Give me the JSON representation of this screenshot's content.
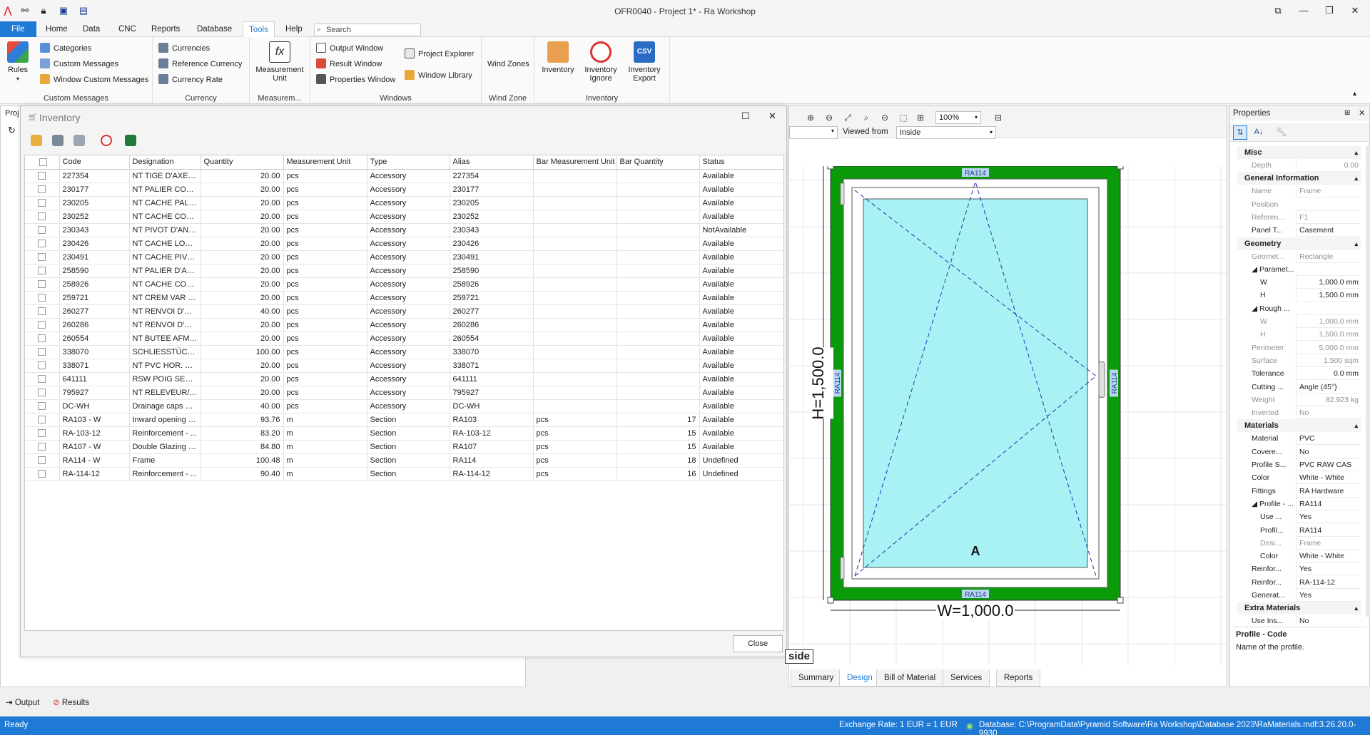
{
  "window": {
    "title": "OFR0040 - Project 1* - Ra Workshop"
  },
  "menu": {
    "file": "File",
    "items": [
      "Home",
      "Data",
      "CNC",
      "Reports",
      "Database",
      "Tools",
      "Help"
    ],
    "active": "Tools",
    "search_placeholder": "Search"
  },
  "ribbon": {
    "rules": "Rules",
    "custom_messages": {
      "label": "Custom Messages",
      "items": [
        "Categories",
        "Custom Messages",
        "Window Custom Messages"
      ]
    },
    "currency": {
      "label": "Currency",
      "items": [
        "Currencies",
        "Reference Currency",
        "Currency Rate"
      ]
    },
    "measurement": {
      "label": "Measurem...",
      "button": "Measurement Unit"
    },
    "windows": {
      "label": "Windows",
      "col1": [
        "Output Window",
        "Result Window",
        "Properties Window"
      ],
      "col2": [
        "Project Explorer",
        "Window Library"
      ]
    },
    "windzone": {
      "label": "Wind Zone",
      "button": "Wind Zones"
    },
    "inventory": {
      "label": "Inventory",
      "buttons": [
        "Inventory",
        "Inventory Ignore",
        "Inventory Export"
      ]
    }
  },
  "left_panel_title": "Proj",
  "inventory": {
    "title": "Inventory",
    "columns": [
      "Code",
      "Designation",
      "Quantity",
      "Measurement Unit",
      "Type",
      "Alias",
      "Bar Measurement Unit",
      "Bar Quantity",
      "Status"
    ],
    "rows": [
      [
        "227354",
        "NT TIGE D'AXE 71",
        "20.00",
        "pcs",
        "Accessory",
        "227354",
        "",
        "",
        "Available"
      ],
      [
        "230177",
        "NT PALIER COMP...",
        "20.00",
        "pcs",
        "Accessory",
        "230177",
        "",
        "",
        "Available"
      ],
      [
        "230205",
        "NT CACHE PALIE...",
        "20.00",
        "pcs",
        "Accessory",
        "230205",
        "",
        "",
        "Available"
      ],
      [
        "230252",
        "NT CACHE COMP...",
        "20.00",
        "pcs",
        "Accessory",
        "230252",
        "",
        "",
        "Available"
      ],
      [
        "230343",
        "NT PIVOT D'ANG...",
        "20.00",
        "pcs",
        "Accessory",
        "230343",
        "",
        "",
        "NotAvailable"
      ],
      [
        "230426",
        "NT CACHE LONG ...",
        "20.00",
        "pcs",
        "Accessory",
        "230426",
        "",
        "",
        "Available"
      ],
      [
        "230491",
        "NT CACHE PIVOT...",
        "20.00",
        "pcs",
        "Accessory",
        "230491",
        "",
        "",
        "Available"
      ],
      [
        "258590",
        "NT PALIER D'AN...",
        "20.00",
        "pcs",
        "Accessory",
        "258590",
        "",
        "",
        "Available"
      ],
      [
        "258926",
        "NT CACHE COUR...",
        "20.00",
        "pcs",
        "Accessory",
        "258926",
        "",
        "",
        "Available"
      ],
      [
        "259721",
        "NT CREM VAR F1...",
        "20.00",
        "pcs",
        "Accessory",
        "259721",
        "",
        "",
        "Available"
      ],
      [
        "260277",
        "NT RENVOI D'AN...",
        "40.00",
        "pcs",
        "Accessory",
        "260277",
        "",
        "",
        "Available"
      ],
      [
        "260286",
        "NT RENVOI D'AN...",
        "20.00",
        "pcs",
        "Accessory",
        "260286",
        "",
        "",
        "Available"
      ],
      [
        "260554",
        "NT BUTEE AFM R...",
        "20.00",
        "pcs",
        "Accessory",
        "260554",
        "",
        "",
        "Available"
      ],
      [
        "338070",
        "SCHLIESSTÜCK K...",
        "100.00",
        "pcs",
        "Accessory",
        "338070",
        "",
        "",
        "Available"
      ],
      [
        "338071",
        "NT PVC HOR. T&...",
        "20.00",
        "pcs",
        "Accessory",
        "338071",
        "",
        "",
        "Available"
      ],
      [
        "641111",
        "RSW POIG SEC C...",
        "20.00",
        "pcs",
        "Accessory",
        "641111",
        "",
        "",
        "Available"
      ],
      [
        "795927",
        "NT RELEVEUR/AFM",
        "20.00",
        "pcs",
        "Accessory",
        "795927",
        "",
        "",
        "Available"
      ],
      [
        "DC-WH",
        "Drainage caps W...",
        "40.00",
        "pcs",
        "Accessory",
        "DC-WH",
        "",
        "",
        "Available"
      ],
      [
        "RA103 - W",
        "Inward opening c...",
        "93.76",
        "m",
        "Section",
        "RA103",
        "pcs",
        "17",
        "Available"
      ],
      [
        "RA-103-12",
        "Reinforcement - ...",
        "83.20",
        "m",
        "Section",
        "RA-103-12",
        "pcs",
        "15",
        "Available"
      ],
      [
        "RA107 - W",
        "Double Glazing B...",
        "84.80",
        "m",
        "Section",
        "RA107",
        "pcs",
        "15",
        "Available"
      ],
      [
        "RA114 - W",
        "Frame",
        "100.48",
        "m",
        "Section",
        "RA114",
        "pcs",
        "18",
        "Undefined"
      ],
      [
        "RA-114-12",
        "Reinforcement - ...",
        "90.40",
        "m",
        "Section",
        "RA-114-12",
        "pcs",
        "16",
        "Undefined"
      ]
    ],
    "close": "Close"
  },
  "design": {
    "zoom": "100%",
    "viewed_from_label": "Viewed from",
    "viewed_from": "Inside",
    "profile_label": "RA114",
    "height_label": "H=1,500.0",
    "width_label": "W=1,000.0",
    "sash_label": "A",
    "inside_tag": "side",
    "tabs": [
      "Summary",
      "Design",
      "Bill of Material",
      "Services",
      "Reports"
    ],
    "active_tab": "Design"
  },
  "properties": {
    "title": "Properties",
    "sections": [
      {
        "name": "Misc",
        "rows": [
          {
            "k": "Depth",
            "v": "0.00",
            "dim": true,
            "r": true
          }
        ]
      },
      {
        "name": "General Information",
        "rows": [
          {
            "k": "Name",
            "v": "Frame",
            "dim": true
          },
          {
            "k": "Position",
            "v": "",
            "dim": true
          },
          {
            "k": "Referen...",
            "v": "F1",
            "dim": true
          },
          {
            "k": "Panel T...",
            "v": "Casement"
          }
        ]
      },
      {
        "name": "Geometry",
        "rows": [
          {
            "k": "Geomet...",
            "v": "Rectangle",
            "dim": true
          },
          {
            "k": "◢ Paramet...",
            "v": ""
          },
          {
            "k": "W",
            "v": "1,000.0 mm",
            "r": true,
            "ind": true
          },
          {
            "k": "H",
            "v": "1,500.0 mm",
            "r": true,
            "ind": true
          },
          {
            "k": "◢ Rough ...",
            "v": ""
          },
          {
            "k": "W",
            "v": "1,000.0 mm",
            "dim": true,
            "r": true,
            "ind": true
          },
          {
            "k": "H",
            "v": "1,500.0 mm",
            "dim": true,
            "r": true,
            "ind": true
          },
          {
            "k": "Perimeter",
            "v": "5,000.0 mm",
            "dim": true,
            "r": true
          },
          {
            "k": "Surface",
            "v": "1.500 sqm",
            "dim": true,
            "r": true
          },
          {
            "k": "Tolerance",
            "v": "0.0 mm",
            "r": true
          },
          {
            "k": "Cutting ...",
            "v": "Angle (45°)"
          },
          {
            "k": "Weight",
            "v": "82.923 kg",
            "dim": true,
            "r": true
          },
          {
            "k": "Inverted",
            "v": "No",
            "dim": true
          }
        ]
      },
      {
        "name": "Materials",
        "rows": [
          {
            "k": "Material",
            "v": "PVC"
          },
          {
            "k": "Covere...",
            "v": "No"
          },
          {
            "k": "Profile S...",
            "v": "PVC RAW CAS"
          },
          {
            "k": "Color",
            "v": "White - White"
          },
          {
            "k": "Fittings",
            "v": "RA Hardware"
          },
          {
            "k": "◢ Profile - ...",
            "v": "RA114"
          },
          {
            "k": "Use ...",
            "v": "Yes",
            "ind": true
          },
          {
            "k": "Profil...",
            "v": "RA114",
            "ind": true
          },
          {
            "k": "Desi...",
            "v": "Frame",
            "dim": true,
            "ind": true
          },
          {
            "k": "Color",
            "v": "White - White",
            "ind": true
          },
          {
            "k": "Reinfor...",
            "v": "Yes"
          },
          {
            "k": "Reinfor...",
            "v": "RA-114-12"
          },
          {
            "k": "Generat...",
            "v": "Yes"
          }
        ]
      },
      {
        "name": "Extra Materials",
        "rows": [
          {
            "k": "Use Ins...",
            "v": "No"
          }
        ]
      }
    ],
    "desc_title": "Profile - Code",
    "desc_text": "Name of the profile."
  },
  "bottom": {
    "output": "Output",
    "results": "Results"
  },
  "status": {
    "ready": "Ready",
    "exchange": "Exchange Rate: 1 EUR = 1 EUR",
    "database": "Database: C:\\ProgramData\\Pyramid Software\\Ra Workshop\\Database 2023\\RaMaterials.mdf:3.26.20.0-9930"
  },
  "colors": {
    "accent": "#1f7ad6",
    "frame": "#0a9a0a",
    "glass": "#a8f2f5"
  }
}
